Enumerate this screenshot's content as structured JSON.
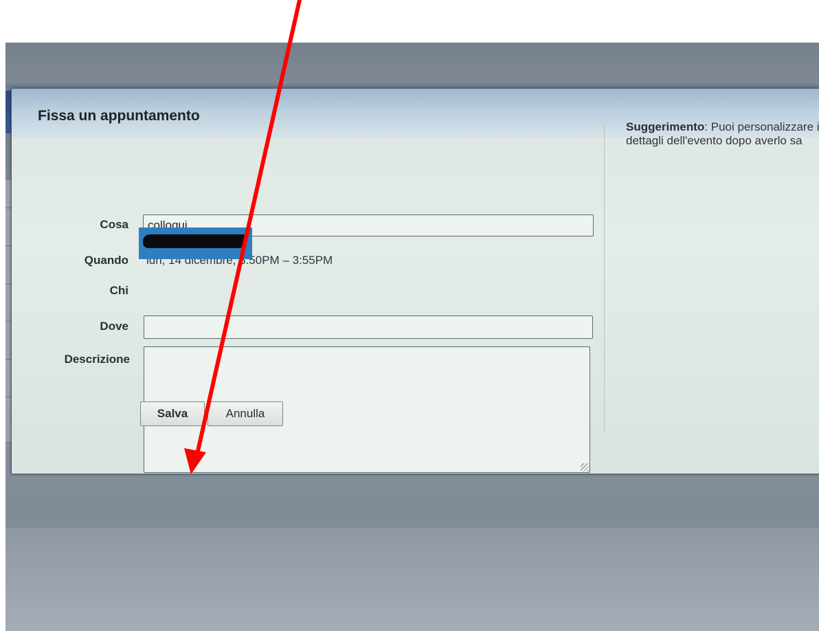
{
  "dialog": {
    "title": "Fissa un appuntamento",
    "fields": {
      "cosa_label": "Cosa",
      "cosa_value": "colloqui",
      "quando_label": "Quando",
      "quando_value": "lun, 14 dicembre, 3:50PM – 3:55PM",
      "chi_label": "Chi",
      "dove_label": "Dove",
      "dove_value": "",
      "descrizione_label": "Descrizione",
      "descrizione_value": ""
    },
    "buttons": {
      "save_label": "Salva",
      "cancel_label": "Annulla"
    },
    "tip": {
      "heading": "Suggerimento",
      "text": ": Puoi personalizzare i dettagli dell'evento dopo averlo sa"
    }
  },
  "colors": {
    "annotation_arrow": "#ff0000",
    "header_band": "#2f4a7e",
    "chi_highlight": "#2e7fc0"
  },
  "icons": [
    "resize-grip-icon",
    "red-arrow-annotation"
  ]
}
